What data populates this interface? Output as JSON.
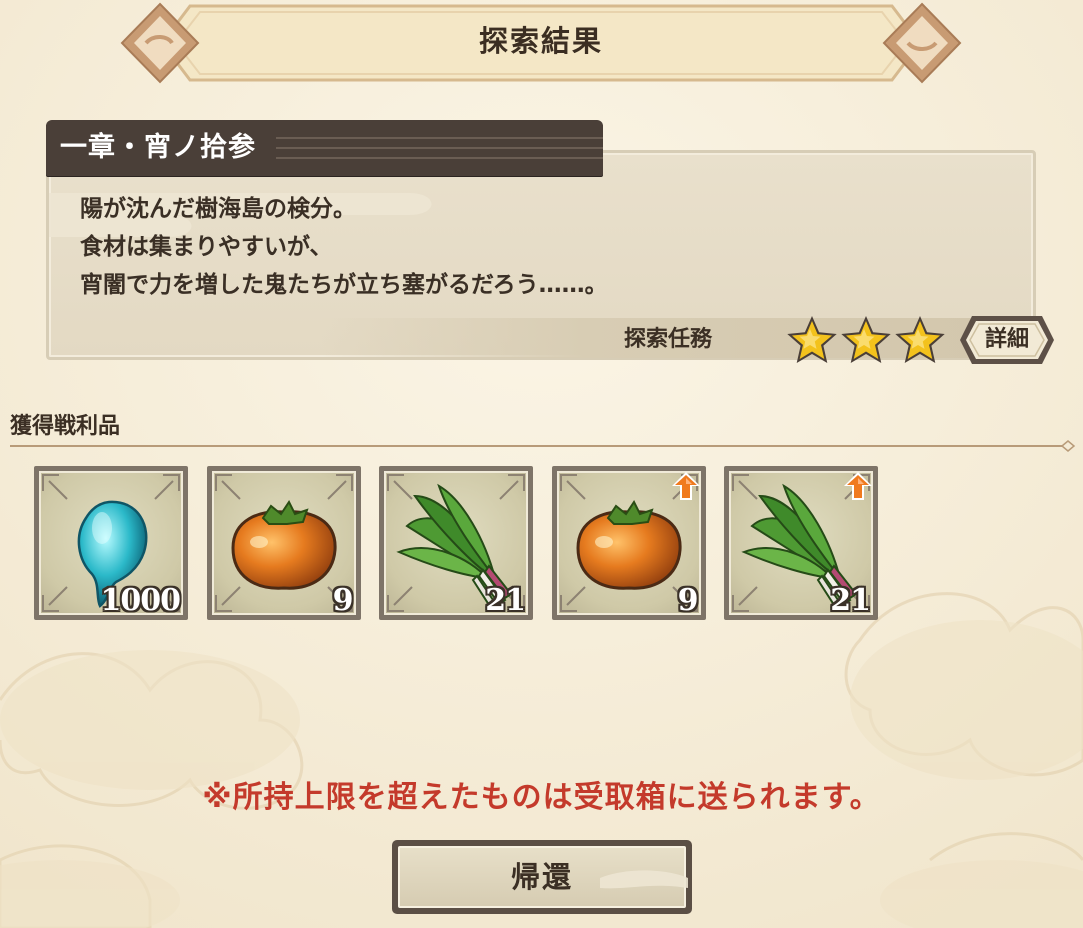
{
  "header": {
    "title": "探索結果"
  },
  "chapter": {
    "title": "一章・宵ノ拾参",
    "description": [
      "陽が沈んだ樹海島の検分。",
      "食材は集まりやすいが、",
      "宵闇で力を増した鬼たちが立ち塞がるだろう……。"
    ],
    "mission_label": "探索任務",
    "stars_earned": 3,
    "stars_total": 3,
    "detail_label": "詳細"
  },
  "loot": {
    "title": "獲得戦利品",
    "items": [
      {
        "icon": "blue-spirit-orb-icon",
        "quantity": "1000",
        "boosted": false
      },
      {
        "icon": "persimmon-icon",
        "quantity": "9",
        "boosted": false
      },
      {
        "icon": "green-onion-icon",
        "quantity": "21",
        "boosted": false
      },
      {
        "icon": "persimmon-icon",
        "quantity": "9",
        "boosted": true
      },
      {
        "icon": "green-onion-icon",
        "quantity": "21",
        "boosted": true
      }
    ]
  },
  "notice": "※所持上限を超えたものは受取箱に送られます。",
  "return_label": "帰還",
  "colors": {
    "background": "#f6eedb",
    "notice_red": "#c43a2b",
    "star_gold": "#f3c21c",
    "up_arrow_orange": "#f07a1e"
  }
}
